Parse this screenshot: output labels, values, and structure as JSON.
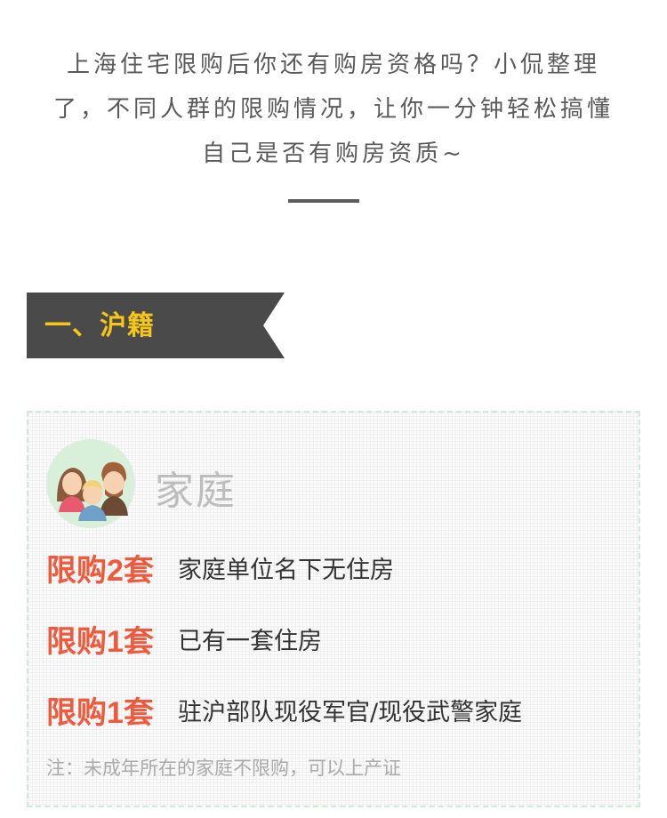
{
  "intro": {
    "lines": [
      "上海住宅限购后你还有购房资格吗？小侃整理",
      "了，不同人群的限购情况，让你一分钟轻松搞懂",
      "自己是否有购房资质~"
    ]
  },
  "section": {
    "title": "一、沪籍",
    "banner_color": "#4a4a4a",
    "title_color": "#f5c518"
  },
  "card": {
    "icon": "family-icon",
    "category": "家庭",
    "rules": [
      {
        "tag": "限购2套",
        "desc": "家庭单位名下无住房"
      },
      {
        "tag": "限购1套",
        "desc": "已有一套住房"
      },
      {
        "tag": "限购1套",
        "desc": "驻沪部队现役军官/现役武警家庭"
      }
    ],
    "note": "注：未成年所在的家庭不限购，可以上产证",
    "accent_color": "#ef5a3c"
  }
}
